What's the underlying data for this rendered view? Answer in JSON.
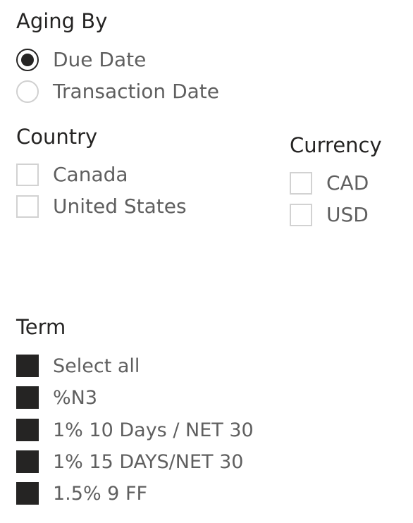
{
  "aging_by": {
    "title": "Aging By",
    "options": [
      {
        "label": "Due Date",
        "selected": true
      },
      {
        "label": "Transaction Date",
        "selected": false
      }
    ]
  },
  "country": {
    "title": "Country",
    "options": [
      {
        "label": "Canada",
        "checked": false
      },
      {
        "label": "United States",
        "checked": false
      }
    ]
  },
  "currency": {
    "title": "Currency",
    "options": [
      {
        "label": "CAD",
        "checked": false
      },
      {
        "label": "USD",
        "checked": false
      }
    ]
  },
  "term": {
    "title": "Term",
    "options": [
      {
        "label": "Select all",
        "checked": true
      },
      {
        "label": "%N3",
        "checked": true
      },
      {
        "label": "1% 10 Days / NET 30",
        "checked": true
      },
      {
        "label": "1% 15 DAYS/NET 30",
        "checked": true
      },
      {
        "label": "1.5% 9 FF",
        "checked": true
      }
    ]
  }
}
